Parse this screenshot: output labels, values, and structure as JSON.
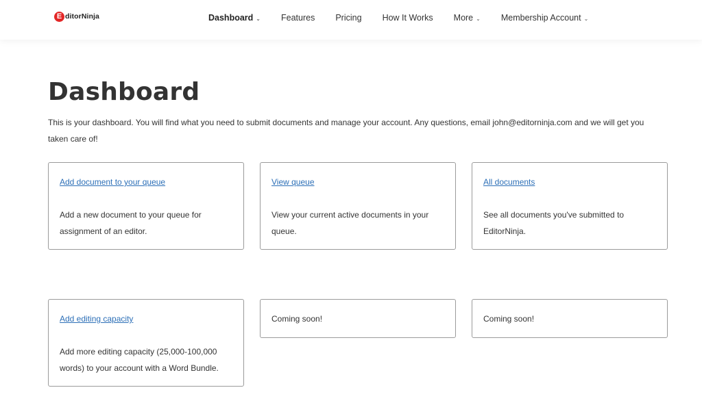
{
  "brand": {
    "logo_mark": "E",
    "logo_text": "ditorNinja"
  },
  "nav": {
    "items": [
      {
        "label": "Dashboard",
        "has_dropdown": true,
        "active": true
      },
      {
        "label": "Features",
        "has_dropdown": false
      },
      {
        "label": "Pricing",
        "has_dropdown": false
      },
      {
        "label": "How It Works",
        "has_dropdown": false
      },
      {
        "label": "More",
        "has_dropdown": true
      },
      {
        "label": "Membership Account",
        "has_dropdown": true
      }
    ],
    "chevron": "⌄"
  },
  "page": {
    "title": "Dashboard",
    "intro": "This is your dashboard. You will find what you need to submit documents and manage your account. Any questions, email john@editorninja.com and we will get you taken care of!"
  },
  "cards": [
    {
      "link": "Add document to your queue",
      "desc": "Add a new document to your queue for assignment of an editor."
    },
    {
      "link": "View queue",
      "desc": "View your current active documents in your queue."
    },
    {
      "link": "All documents",
      "desc": "See all documents you've submitted to EditorNinja."
    },
    {
      "link": "Add editing capacity",
      "desc": "Add more editing capacity (25,000-100,000 words) to your account with a Word Bundle."
    },
    {
      "text": "Coming soon!"
    },
    {
      "text": "Coming soon!"
    }
  ],
  "colors": {
    "link": "#2c6fb7",
    "logo_red": "#e32626",
    "border": "#9a9a9a"
  }
}
